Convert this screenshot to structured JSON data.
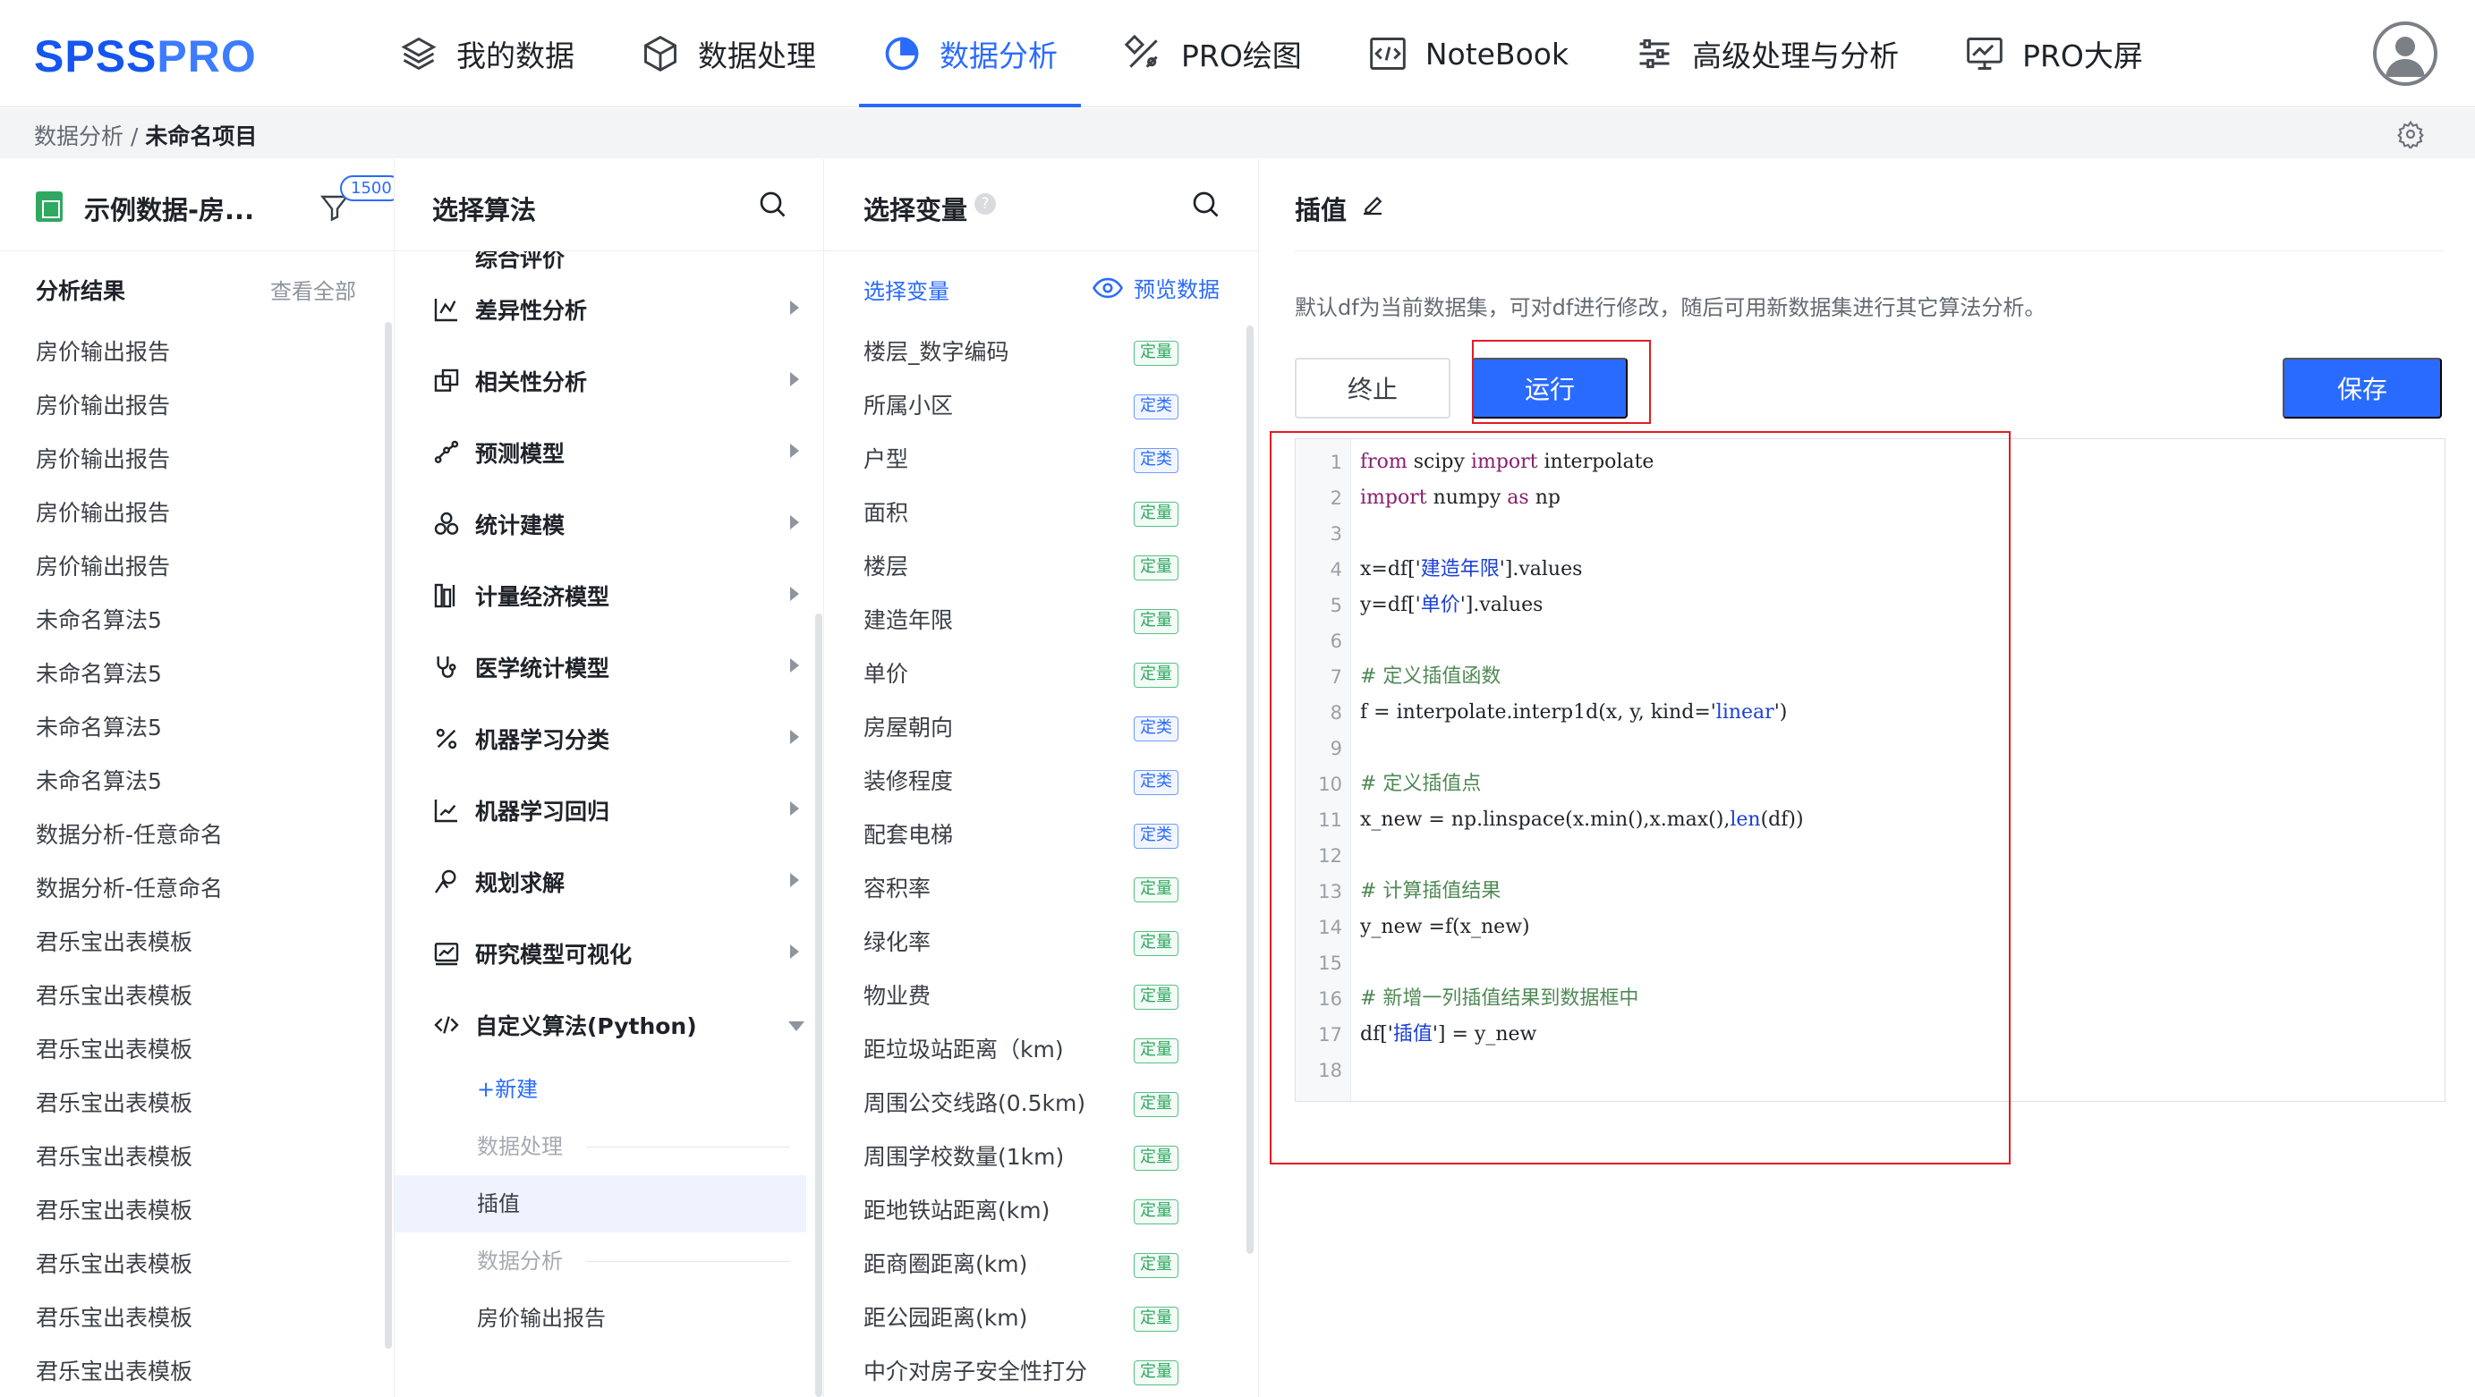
{
  "app": {
    "logo_prefix": "SPSS",
    "logo_suffix": "PRO",
    "brand_color": "#1456f0",
    "accent_color": "#2a6bff"
  },
  "nav": {
    "items": [
      {
        "label": "我的数据",
        "icon": "layers-icon"
      },
      {
        "label": "数据处理",
        "icon": "cube-icon"
      },
      {
        "label": "数据分析",
        "icon": "pie-chart-icon",
        "active": true
      },
      {
        "label": "PRO绘图",
        "icon": "draw-tools-icon"
      },
      {
        "label": "NoteBook",
        "icon": "code-window-icon"
      },
      {
        "label": "高级处理与分析",
        "icon": "sliders-icon"
      },
      {
        "label": "PRO大屏",
        "icon": "dashboard-icon"
      }
    ]
  },
  "breadcrumb": {
    "parent": "数据分析",
    "separator": " / ",
    "current": "未命名项目"
  },
  "dataset": {
    "title": "示例数据-房...",
    "count_badge": "1500",
    "results_heading": "分析结果",
    "see_all": "查看全部",
    "results": [
      "房价输出报告",
      "房价输出报告",
      "房价输出报告",
      "房价输出报告",
      "房价输出报告",
      "未命名算法5",
      "未命名算法5",
      "未命名算法5",
      "未命名算法5",
      "数据分析-任意命名",
      "数据分析-任意命名",
      "君乐宝出表模板",
      "君乐宝出表模板",
      "君乐宝出表模板",
      "君乐宝出表模板",
      "君乐宝出表模板",
      "君乐宝出表模板",
      "君乐宝出表模板",
      "君乐宝出表模板",
      "君乐宝出表模板"
    ]
  },
  "algorithms": {
    "title": "选择算法",
    "clipped_item": "综合评价",
    "items": [
      {
        "label": "差异性分析",
        "icon": "difference-icon"
      },
      {
        "label": "相关性分析",
        "icon": "correlation-icon"
      },
      {
        "label": "预测模型",
        "icon": "forecast-icon"
      },
      {
        "label": "统计建模",
        "icon": "stat-model-icon"
      },
      {
        "label": "计量经济模型",
        "icon": "econometric-icon"
      },
      {
        "label": "医学统计模型",
        "icon": "stethoscope-icon"
      },
      {
        "label": "机器学习分类",
        "icon": "percent-icon"
      },
      {
        "label": "机器学习回归",
        "icon": "regression-icon"
      },
      {
        "label": "规划求解",
        "icon": "planning-icon"
      },
      {
        "label": "研究模型可视化",
        "icon": "visualization-icon"
      }
    ],
    "custom": {
      "label": "自定义算法(Python)",
      "new_label": "+新建",
      "folders": [
        {
          "label": "数据处理",
          "children": [
            "插值"
          ]
        },
        {
          "label": "数据分析",
          "children": [
            "房价输出报告"
          ]
        }
      ],
      "selected": "插值"
    }
  },
  "variables": {
    "title": "选择变量",
    "subheading": "选择变量",
    "preview_label": "预览数据",
    "tag_quant": "定量",
    "tag_cat": "定类",
    "items": [
      {
        "name": "楼层_数字编码",
        "type": "定量"
      },
      {
        "name": "所属小区",
        "type": "定类"
      },
      {
        "name": "户型",
        "type": "定类"
      },
      {
        "name": "面积",
        "type": "定量"
      },
      {
        "name": "楼层",
        "type": "定量"
      },
      {
        "name": "建造年限",
        "type": "定量"
      },
      {
        "name": "单价",
        "type": "定量"
      },
      {
        "name": "房屋朝向",
        "type": "定类"
      },
      {
        "name": "装修程度",
        "type": "定类"
      },
      {
        "name": "配套电梯",
        "type": "定类"
      },
      {
        "name": "容积率",
        "type": "定量"
      },
      {
        "name": "绿化率",
        "type": "定量"
      },
      {
        "name": "物业费",
        "type": "定量"
      },
      {
        "name": "距垃圾站距离（km)",
        "type": "定量"
      },
      {
        "name": "周围公交线路(0.5km)",
        "type": "定量"
      },
      {
        "name": "周围学校数量(1km)",
        "type": "定量"
      },
      {
        "name": "距地铁站距离(km)",
        "type": "定量"
      },
      {
        "name": "距商圈距离(km)",
        "type": "定量"
      },
      {
        "name": "距公园距离(km)",
        "type": "定量"
      },
      {
        "name": "中介对房子安全性打分",
        "type": "定量"
      }
    ]
  },
  "editor_panel": {
    "title": "插值",
    "hint": "默认df为当前数据集，可对df进行修改，随后可用新数据集进行其它算法分析。",
    "stop_label": "终止",
    "run_label": "运行",
    "save_label": "保存",
    "code_lines": [
      [
        {
          "t": "from",
          "c": "kw"
        },
        {
          "t": " scipy "
        },
        {
          "t": "import",
          "c": "kw"
        },
        {
          "t": " interpolate"
        }
      ],
      [
        {
          "t": "import",
          "c": "kw"
        },
        {
          "t": " numpy "
        },
        {
          "t": "as",
          "c": "kw"
        },
        {
          "t": " np"
        }
      ],
      [],
      [
        {
          "t": "x=df['"
        },
        {
          "t": "建造年限",
          "c": "str"
        },
        {
          "t": "'].values"
        }
      ],
      [
        {
          "t": "y=df['"
        },
        {
          "t": "单价",
          "c": "str"
        },
        {
          "t": "'].values"
        }
      ],
      [],
      [
        {
          "t": "# 定义插值函数",
          "c": "cmt"
        }
      ],
      [
        {
          "t": "f = interpolate.interp1d(x, y, kind='"
        },
        {
          "t": "linear",
          "c": "str"
        },
        {
          "t": "')"
        }
      ],
      [],
      [
        {
          "t": "# 定义插值点",
          "c": "cmt"
        }
      ],
      [
        {
          "t": "x_new = np.linspace(x.min(),x.max(),"
        },
        {
          "t": "len",
          "c": "bi"
        },
        {
          "t": "(df))"
        }
      ],
      [],
      [
        {
          "t": "# 计算插值结果",
          "c": "cmt"
        }
      ],
      [
        {
          "t": "y_new =f(x_new)"
        }
      ],
      [],
      [
        {
          "t": "# 新增一列插值结果到数据框中",
          "c": "cmt"
        }
      ],
      [
        {
          "t": "df['"
        },
        {
          "t": "插值",
          "c": "str"
        },
        {
          "t": "'] = y_new"
        }
      ],
      []
    ]
  }
}
